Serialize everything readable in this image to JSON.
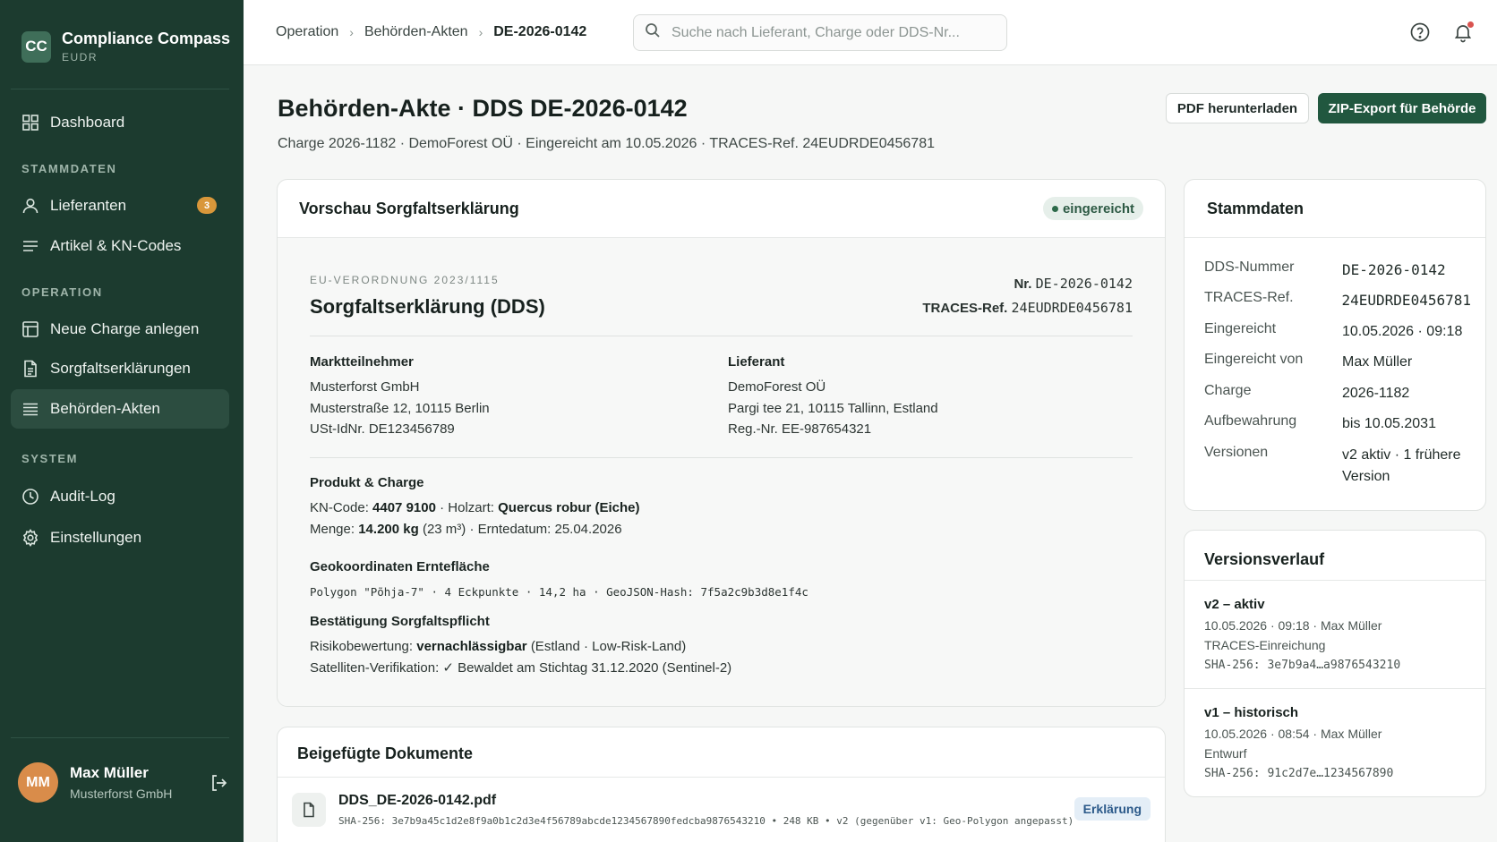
{
  "brand": {
    "logo": "CC",
    "title": "Compliance Compass",
    "subtitle": "EUDR"
  },
  "sidebar": {
    "dashboard": {
      "label": "Dashboard",
      "icon": "grid-icon"
    },
    "sections": {
      "stammdaten": "STAMMDATEN",
      "operation": "OPERATION",
      "system": "SYSTEM"
    },
    "items": [
      {
        "label": "Lieferanten",
        "icon": "user-icon",
        "badge": "3"
      },
      {
        "label": "Artikel & KN-Codes",
        "icon": "list-icon"
      },
      {
        "label": "Neue Charge anlegen",
        "icon": "layout-icon"
      },
      {
        "label": "Sorgfaltserklärungen",
        "icon": "file-text-icon"
      },
      {
        "label": "Behörden-Akten",
        "icon": "list-icon",
        "active": true
      },
      {
        "label": "Audit-Log",
        "icon": "clock-icon"
      },
      {
        "label": "Einstellungen",
        "icon": "gear-icon"
      }
    ],
    "user": {
      "initials": "MM",
      "name": "Max Müller",
      "org": "Musterforst GmbH"
    }
  },
  "topbar": {
    "breadcrumb": [
      "Operation",
      "Behörden-Akten",
      "DE-2026-0142"
    ],
    "search_placeholder": "Suche nach Lieferant, Charge oder DDS-Nr..."
  },
  "header": {
    "title": "Behörden-Akte · DDS DE-2026-0142",
    "subtitle": "Charge 2026-1182 · DemoForest OÜ · Eingereicht am 10.05.2026 · TRACES-Ref. 24EUDRDE0456781",
    "btn_pdf": "PDF herunterladen",
    "btn_zip": "ZIP-Export für Behörde"
  },
  "preview": {
    "title": "Vorschau Sorgfaltserklärung",
    "status": "eingereicht",
    "eyebrow": "EU-VERORDNUNG 2023/1115",
    "doc_title": "Sorgfaltserklärung (DDS)",
    "nr_label": "Nr.",
    "nr_value": "DE-2026-0142",
    "traces_label": "TRACES-Ref.",
    "traces_value": "24EUDRDE0456781",
    "operator": {
      "heading": "Marktteilnehmer",
      "lines": [
        "Musterforst GmbH",
        "Musterstraße 12, 10115 Berlin",
        "USt-IdNr. DE123456789"
      ]
    },
    "supplier": {
      "heading": "Lieferant",
      "lines": [
        "DemoForest OÜ",
        "Pargi tee 21, 10115 Tallinn, Estland",
        "Reg.-Nr. EE-987654321"
      ]
    },
    "product": {
      "heading": "Produkt & Charge",
      "kn_label": "KN-Code:",
      "kn_value": "4407 9100",
      "wood_label": "· Holzart:",
      "wood_value": "Quercus robur (Eiche)",
      "qty_label": "Menge:",
      "qty_value": "14.200 kg",
      "qty_extra": "(23 m³) · Erntedatum: 25.04.2026"
    },
    "geo": {
      "heading": "Geokoordinaten Erntefläche",
      "line": "Polygon \"Põhja-7\" · 4 Eckpunkte · 14,2 ha · GeoJSON-Hash: 7f5a2c9b3d8e1f4c"
    },
    "confirmation": {
      "heading": "Bestätigung Sorgfaltspflicht",
      "risk_label": "Risikobewertung:",
      "risk_value": "vernachlässigbar",
      "risk_extra": "(Estland · Low-Risk-Land)",
      "sat_line": "Satelliten-Verifikation: ✓ Bewaldet am Stichtag 31.12.2020 (Sentinel-2)"
    }
  },
  "documents": {
    "title": "Beigefügte Dokumente",
    "file_name": "DDS_DE-2026-0142.pdf",
    "file_meta": "SHA-256: 3e7b9a45c1d2e8f9a0b1c2d3e4f56789abcde1234567890fedcba9876543210 • 248 KB • v2 (gegenüber v1: Geo-Polygon angepasst)",
    "tag": "Erklärung"
  },
  "master": {
    "title": "Stammdaten",
    "rows": [
      {
        "k": "DDS-Nummer",
        "v": "DE-2026-0142"
      },
      {
        "k": "TRACES-Ref.",
        "v": "24EUDRDE0456781"
      },
      {
        "k": "Eingereicht",
        "v": "10.05.2026 · 09:18"
      },
      {
        "k": "Eingereicht von",
        "v": "Max Müller"
      },
      {
        "k": "Charge",
        "v": "2026-1182"
      },
      {
        "k": "Aufbewahrung",
        "v": "bis 10.05.2031"
      },
      {
        "k": "Versionen",
        "v": "v2 aktiv · 1 frühere Version"
      }
    ]
  },
  "versions": {
    "title": "Versionsverlauf",
    "items": [
      {
        "title": "v2 – aktiv",
        "meta": "10.05.2026 · 09:18 · Max Müller",
        "note": "TRACES-Einreichung",
        "hash": "SHA-256: 3e7b9a4…a9876543210"
      },
      {
        "title": "v1 – historisch",
        "meta": "10.05.2026 · 08:54 · Max Müller",
        "note": "Entwurf",
        "hash": "SHA-256: 91c2d7e…1234567890"
      }
    ]
  }
}
